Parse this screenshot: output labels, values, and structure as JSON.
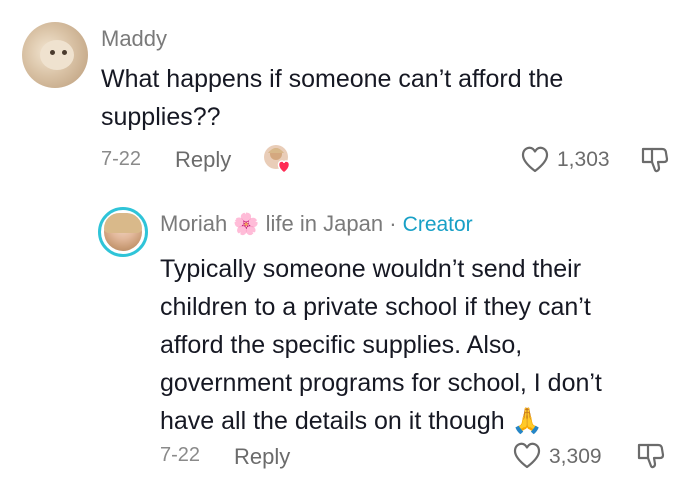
{
  "comments": [
    {
      "username": "Maddy",
      "text_lines": [
        "What happens if someone can’t afford the",
        "supplies??"
      ],
      "date": "7-22",
      "reply_label": "Reply",
      "likes": "1,303",
      "creator_liked": true
    },
    {
      "username_prefix": "Moriah",
      "username_emoji": "🌸",
      "username_suffix": "life in Japan",
      "separator": "·",
      "badge": "Creator",
      "text_lines": [
        "Typically someone wouldn’t send their",
        "children to a private school if they can’t",
        "afford the specific supplies. Also,",
        "government programs for school, I don’t",
        "have all the details on it though"
      ],
      "text_emoji": "🙏",
      "date": "7-22",
      "reply_label": "Reply",
      "likes": "3,309"
    }
  ],
  "colors": {
    "creator_badge": "#18a0c6",
    "avatar_ring": "#2fc4d8",
    "heart_red": "#fe2c55"
  }
}
